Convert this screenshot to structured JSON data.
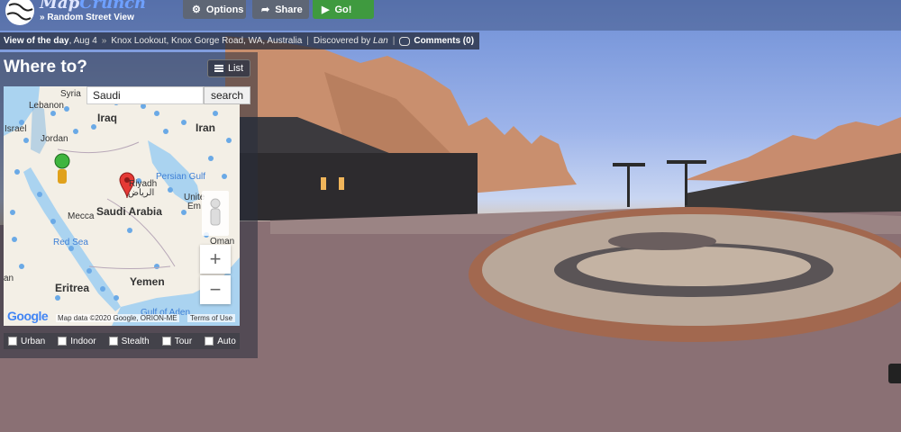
{
  "app": {
    "logo_name_part1": "Map",
    "logo_name_part2": "Crunch",
    "logo_subtitle": "» Random Street View"
  },
  "toolbar": {
    "options_label": "Options",
    "options_icon": "gear-icon",
    "share_label": "Share",
    "share_icon": "share-arrow-icon",
    "go_label": "Go!",
    "go_icon": "play-icon"
  },
  "infobar": {
    "view_of_day_label": "View of the day",
    "date": ", Aug 4",
    "arrow": "»",
    "location": "Knox Lookout, Knox Gorge Road, WA, Australia",
    "discovered_prefix": "Discovered by",
    "discoverer": "Lan",
    "comments_label": "Comments (0)"
  },
  "panel": {
    "title": "Where to?",
    "list_label": "List",
    "search_value": "Saudi",
    "search_button": "search"
  },
  "map": {
    "labels": {
      "syria": "Syria",
      "lebanon": "Lebanon",
      "iraq": "Iraq",
      "israel": "Israel",
      "jordan": "Jordan",
      "iran": "Iran",
      "persian_gulf": "Persian Gulf",
      "riyadh": "Riyadh",
      "riyadh_ar": "الرياض",
      "saudi_arabia": "Saudi Arabia",
      "mecca": "Mecca",
      "united": "Unite",
      "emirates": "Em",
      "red_sea": "Red Sea",
      "oman": "Oman",
      "an": "an",
      "eritrea": "Eritrea",
      "yemen": "Yemen",
      "gulf_of_aden": "Gulf of Aden"
    },
    "zoom_in": "+",
    "zoom_out": "−",
    "google": "Google",
    "attribution": "Map data ©2020 Google, ORION-ME",
    "terms": "Terms of Use"
  },
  "filters": [
    {
      "label": "Urban",
      "checked": false
    },
    {
      "label": "Indoor",
      "checked": false
    },
    {
      "label": "Stealth",
      "checked": false
    },
    {
      "label": "Tour",
      "checked": false
    },
    {
      "label": "Auto",
      "checked": false
    }
  ]
}
